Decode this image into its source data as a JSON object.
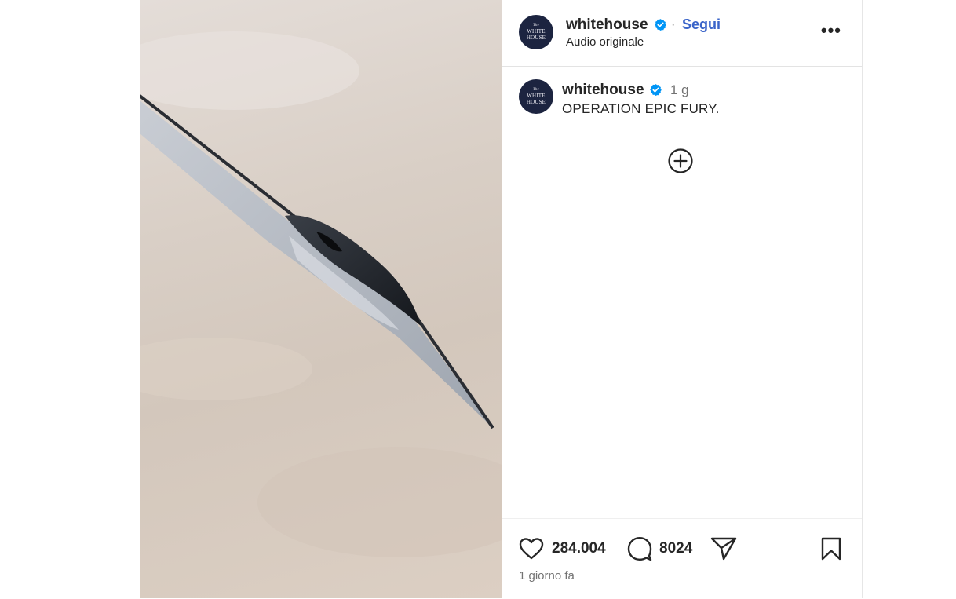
{
  "header": {
    "username": "whitehouse",
    "separator": "·",
    "follow_label": "Segui",
    "audio_label": "Audio originale",
    "more_label": "•••"
  },
  "avatar": {
    "line1": "The",
    "line2": "WHITE",
    "line3": "HOUSE"
  },
  "caption": {
    "username": "whitehouse",
    "time": "1 g",
    "text": "OPERATION EPIC FURY."
  },
  "actions": {
    "likes": "284.004",
    "comments": "8024",
    "posted": "1 giorno fa"
  },
  "colors": {
    "verified": "#0095f6",
    "link": "#3a64c9",
    "secondary_text": "#737373",
    "avatar_bg": "#1c2440"
  },
  "icons": [
    "verified-badge-icon",
    "more-options-icon",
    "add-circle-icon",
    "heart-icon",
    "comment-icon",
    "share-icon",
    "bookmark-icon"
  ]
}
